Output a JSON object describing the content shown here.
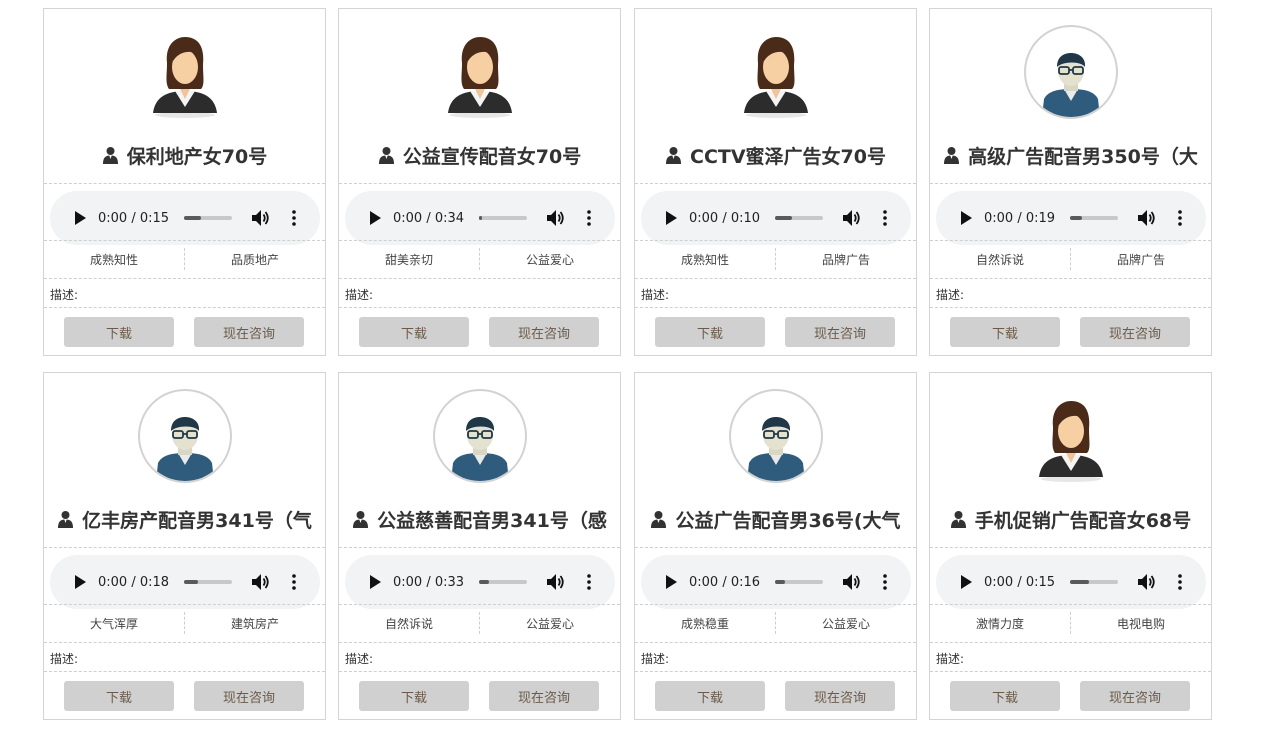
{
  "colors": {
    "card_border": "#d4d4d4",
    "button_bg": "#d0d0d0",
    "button_text": "#6b5a4a",
    "player_bg": "#f1f3f4"
  },
  "labels": {
    "download": "下载",
    "consult": "现在咨询",
    "description": "描述:"
  },
  "cards": [
    {
      "title": "保利地产女70号",
      "avatar": "female-avatar-icon",
      "time": "0:00 / 0:15",
      "progress": 0.35,
      "tags": [
        "成熟知性",
        "品质地产"
      ]
    },
    {
      "title": "公益宣传配音女70号",
      "avatar": "female-avatar-icon",
      "time": "0:00 / 0:34",
      "progress": 0.06,
      "tags": [
        "甜美亲切",
        "公益爱心"
      ]
    },
    {
      "title": "CCTV蜜泽广告女70号",
      "avatar": "female-avatar-icon",
      "time": "0:00 / 0:10",
      "progress": 0.35,
      "tags": [
        "成熟知性",
        "品牌广告"
      ]
    },
    {
      "title": "高级广告配音男350号（大",
      "avatar": "male-avatar-icon",
      "time": "0:00 / 0:19",
      "progress": 0.25,
      "tags": [
        "自然诉说",
        "品牌广告"
      ]
    },
    {
      "title": "亿丰房产配音男341号（气",
      "avatar": "male-avatar-icon",
      "time": "0:00 / 0:18",
      "progress": 0.3,
      "tags": [
        "大气浑厚",
        "建筑房产"
      ]
    },
    {
      "title": "公益慈善配音男341号（感",
      "avatar": "male-avatar-icon",
      "time": "0:00 / 0:33",
      "progress": 0.2,
      "tags": [
        "自然诉说",
        "公益爱心"
      ]
    },
    {
      "title": "公益广告配音男36号(大气",
      "avatar": "male-avatar-icon",
      "time": "0:00 / 0:16",
      "progress": 0.2,
      "tags": [
        "成熟稳重",
        "公益爱心"
      ]
    },
    {
      "title": "手机促销广告配音女68号",
      "avatar": "female-avatar-icon",
      "time": "0:00 / 0:15",
      "progress": 0.4,
      "tags": [
        "激情力度",
        "电视电购"
      ]
    }
  ]
}
